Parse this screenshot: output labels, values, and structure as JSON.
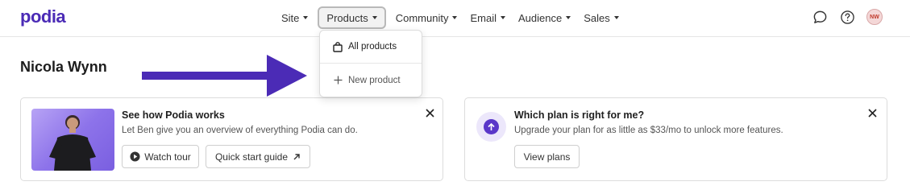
{
  "app": {
    "logo": "podia"
  },
  "nav": {
    "items": [
      {
        "label": "Site"
      },
      {
        "label": "Products"
      },
      {
        "label": "Community"
      },
      {
        "label": "Email"
      },
      {
        "label": "Audience"
      },
      {
        "label": "Sales"
      }
    ],
    "active": "Products",
    "user_initials": "NW"
  },
  "dropdown": {
    "items": [
      {
        "label": "All products",
        "icon": "shopping-bag-icon"
      },
      {
        "label": "New product",
        "icon": "plus-icon"
      }
    ]
  },
  "page": {
    "title": "Nicola Wynn"
  },
  "cards": {
    "tour": {
      "title": "See how Podia works",
      "description": "Let Ben give you an overview of everything Podia can do.",
      "watch_label": "Watch tour",
      "guide_label": "Quick start guide"
    },
    "plan": {
      "title": "Which plan is right for me?",
      "description": "Upgrade your plan for as little as $33/mo to unlock more features.",
      "button_label": "View plans"
    }
  },
  "colors": {
    "brand": "#4b2bb6",
    "arrow": "#4b2bb6"
  }
}
